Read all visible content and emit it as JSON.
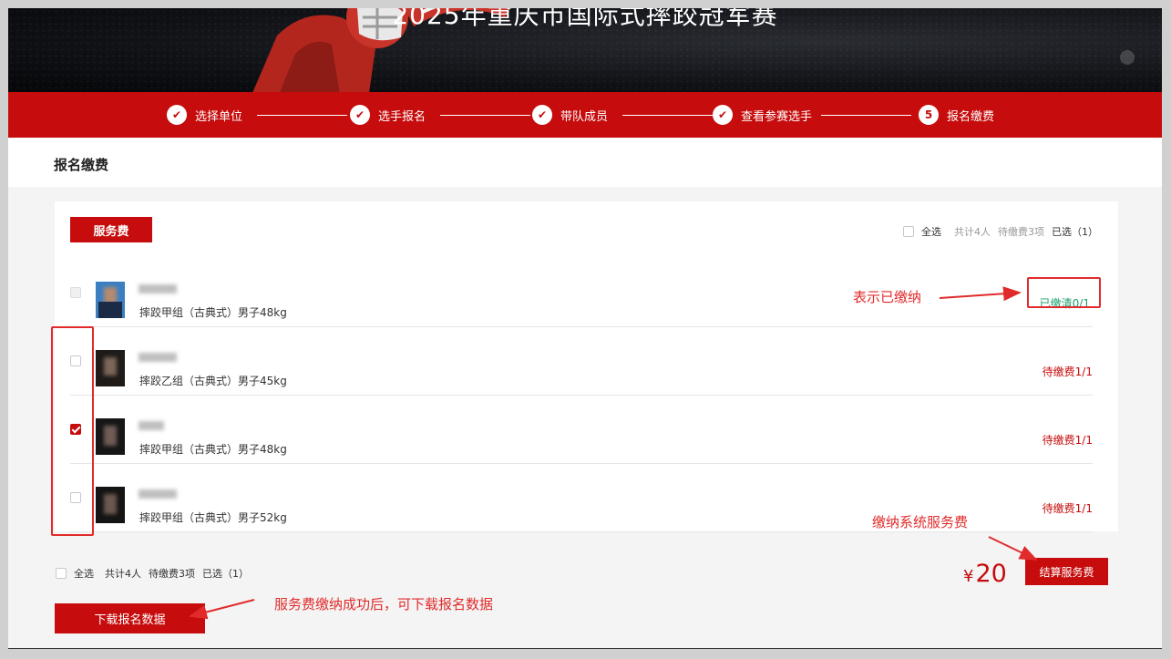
{
  "hero": {
    "title": "2025年重庆市国际式摔跤冠军赛"
  },
  "steps": [
    {
      "label": "选择单位",
      "marker": "check-icon",
      "done": true
    },
    {
      "label": "选手报名",
      "marker": "check-icon",
      "done": true
    },
    {
      "label": "带队成员",
      "marker": "check-icon",
      "done": true
    },
    {
      "label": "查看参赛选手",
      "marker": "check-icon",
      "done": true
    },
    {
      "label": "报名缴费",
      "number": "5",
      "done": false
    }
  ],
  "page": {
    "title": "报名缴费"
  },
  "card": {
    "tab_label": "服务费",
    "summary": {
      "select_all": "全选",
      "total": "共计4人",
      "pending": "待缴费3项",
      "selected": "已选（1）"
    }
  },
  "rows": [
    {
      "desc": "摔跤甲组（古典式）男子48kg",
      "status": "已缴清0/1",
      "status_type": "paid",
      "checked": false,
      "disabled": true
    },
    {
      "desc": "摔跤乙组（古典式）男子45kg",
      "status": "待缴费1/1",
      "status_type": "due",
      "checked": false,
      "disabled": false
    },
    {
      "desc": "摔跤甲组（古典式）男子48kg",
      "status": "待缴费1/1",
      "status_type": "due",
      "checked": true,
      "disabled": false
    },
    {
      "desc": "摔跤甲组（古典式）男子52kg",
      "status": "待缴费1/1",
      "status_type": "due",
      "checked": false,
      "disabled": false
    }
  ],
  "bottom": {
    "select_all": "全选",
    "total": "共计4人",
    "pending": "待缴费3项",
    "selected": "已选（1）",
    "currency": "¥",
    "amount": "20",
    "settle_button": "结算服务费",
    "download_button": "下载报名数据"
  },
  "annotations": {
    "paid_note": "表示已缴纳",
    "pay_note": "缴纳系统服务费",
    "download_note": "服务费缴纳成功后，可下载报名数据"
  },
  "colors": {
    "brand_red": "#c60c0c",
    "paid_green": "#1aa16b",
    "annotation_red": "#e12b2b"
  }
}
